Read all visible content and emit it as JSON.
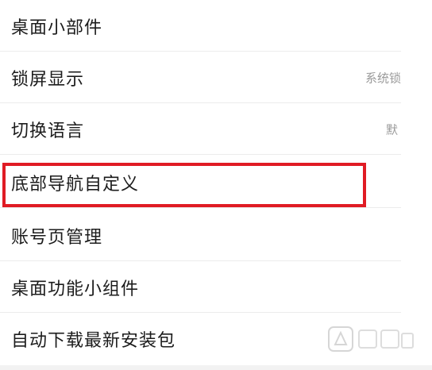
{
  "settings": {
    "items": [
      {
        "label": "桌面小部件",
        "value": ""
      },
      {
        "label": "锁屏显示",
        "value": "系统锁"
      },
      {
        "label": "切换语言",
        "value": "默"
      },
      {
        "label": "底部导航自定义",
        "value": ""
      },
      {
        "label": "账号页管理",
        "value": ""
      },
      {
        "label": "桌面功能小组件",
        "value": ""
      },
      {
        "label": "自动下载最新安装包",
        "value": ""
      }
    ]
  },
  "highlight": {
    "color": "#e01b24"
  },
  "watermark": {
    "icon": "watermark-logo-icon"
  }
}
